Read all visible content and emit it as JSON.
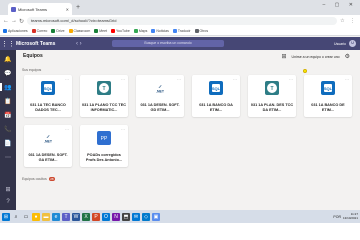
{
  "browser": {
    "tab_title": "Microsoft Teams",
    "url": "teams.microsoft.com/_#/school//?ctx=teamsGrid",
    "bookmarks": [
      {
        "label": "Aplicaciones",
        "color": "#1a73e8"
      },
      {
        "label": "Correo",
        "color": "#d93025"
      },
      {
        "label": "Drive",
        "color": "#188038"
      },
      {
        "label": "Classroom",
        "color": "#f9ab00"
      },
      {
        "label": "Meet",
        "color": "#188038"
      },
      {
        "label": "YouTube",
        "color": "#ff0000"
      },
      {
        "label": "Maps",
        "color": "#34a853"
      },
      {
        "label": "Noticias",
        "color": "#4285f4"
      },
      {
        "label": "Traducir",
        "color": "#4285f4"
      },
      {
        "label": "Otros",
        "color": "#5f6368"
      }
    ]
  },
  "teams": {
    "app_name": "Microsoft Teams",
    "search_placeholder": "Busque o escriba un comando",
    "user_name": "Usuario",
    "user_initials": "U",
    "page_title": "Equipos",
    "join_button": "Unirse a un equipo o crear uno",
    "section_label": "Sus equipos",
    "hidden_label": "Equipos ocultos",
    "hidden_count": "28"
  },
  "cards": [
    {
      "name": "031 1A TEC BANCO DADOS TEC...",
      "icon": "sql-server-icon",
      "color": "#0f6cbd"
    },
    {
      "name": "031 1A PLANO TCC TEC INFORMATIC...",
      "icon": "tcc-icon",
      "color": "#2e7d86"
    },
    {
      "name": "031 1A DESEN. SOFT. GD ETIM...",
      "icon": "dotnet-icon",
      "color": "#1b4a7a"
    },
    {
      "name": "031 1A BANCO DA ETIM...",
      "icon": "sql-server-icon",
      "color": "#0f6cbd"
    },
    {
      "name": "031 1A PLAN. DES TCC DA ETIM...",
      "icon": "tcc-icon",
      "color": "#2e7d86"
    },
    {
      "name": "031 1A BANCO DE ETIM...",
      "icon": "sql-server-icon",
      "color": "#0f6cbd"
    },
    {
      "name": "031 1A DESEN. SOFT. GA ETIM...",
      "icon": "dotnet-icon",
      "color": "#1b4a7a"
    },
    {
      "name": "POADs corregidos Profs Des Antonio...",
      "icon": "pp-icon",
      "color": "#2f6fd0"
    }
  ],
  "taskbar": {
    "lang": "POR",
    "time": "11:27",
    "date": "13/10/2021"
  }
}
